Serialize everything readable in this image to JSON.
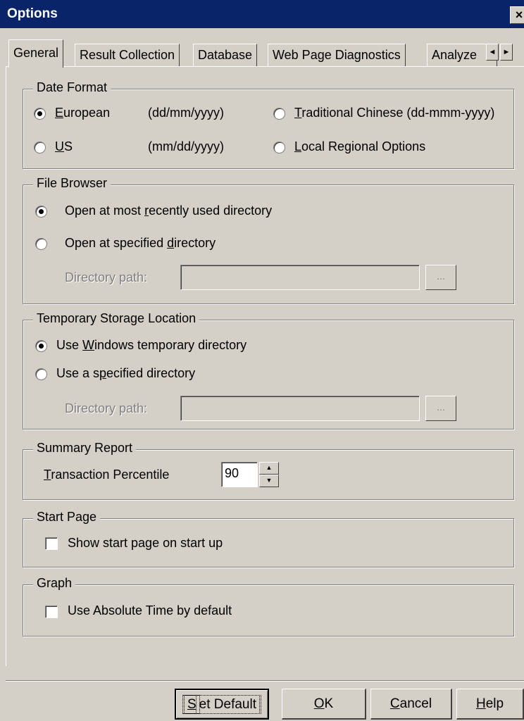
{
  "window": {
    "title": "Options",
    "close_glyph": "×"
  },
  "tabs": [
    {
      "label": "General"
    },
    {
      "label": "Result Collection"
    },
    {
      "label": "Database"
    },
    {
      "label": "Web Page Diagnostics"
    },
    {
      "label": "Analyze"
    }
  ],
  "tab_scroll": {
    "left_glyph": "◄",
    "right_glyph": "►"
  },
  "date_format": {
    "legend": "Date Format",
    "european": {
      "label_u": "E",
      "label_rest": "uropean",
      "format": "(dd/mm/yyyy)",
      "selected": true
    },
    "us": {
      "label_u": "U",
      "label_rest": "S",
      "format": "(mm/dd/yyyy)",
      "selected": false
    },
    "traditional_chinese": {
      "label_u": "T",
      "label_rest": "raditional Chinese (dd-mmm-yyyy)",
      "selected": false
    },
    "local_regional": {
      "label_u": "L",
      "label_rest": "ocal Regional Options",
      "selected": false
    }
  },
  "file_browser": {
    "legend": "File Browser",
    "recent": {
      "label_pre": "Open at most ",
      "label_u": "r",
      "label_post": "ecently used directory",
      "selected": true
    },
    "specified": {
      "label_pre": "Open at specified ",
      "label_u": "d",
      "label_post": "irectory",
      "selected": false
    },
    "path_label": "Directory  path:",
    "path_value": "",
    "browse_label": "..."
  },
  "temp_storage": {
    "legend": "Temporary Storage Location",
    "windows": {
      "label_pre": "Use ",
      "label_u": "W",
      "label_post": "indows temporary directory",
      "selected": true
    },
    "specified": {
      "label_pre": "Use a s",
      "label_u": "p",
      "label_post": "ecified directory",
      "selected": false
    },
    "path_label": "Directory  path:",
    "path_value": "",
    "browse_label": "..."
  },
  "summary_report": {
    "legend": "Summary Report",
    "percentile_label_u": "T",
    "percentile_label_rest": "ransaction Percentile",
    "percentile_value": "90",
    "spin_up": "▲",
    "spin_down": "▼"
  },
  "start_page": {
    "legend": "Start Page",
    "show_label": "Show start page on start up",
    "checked": false
  },
  "graph": {
    "legend": "Graph",
    "absolute_time_label": "Use Absolute Time by default",
    "checked": false
  },
  "buttons": {
    "set_default_u": "S",
    "set_default_rest": "et Default",
    "ok_u": "O",
    "ok_rest": "K",
    "cancel_u": "C",
    "cancel_rest": "ancel",
    "help_u": "H",
    "help_rest": "elp"
  }
}
